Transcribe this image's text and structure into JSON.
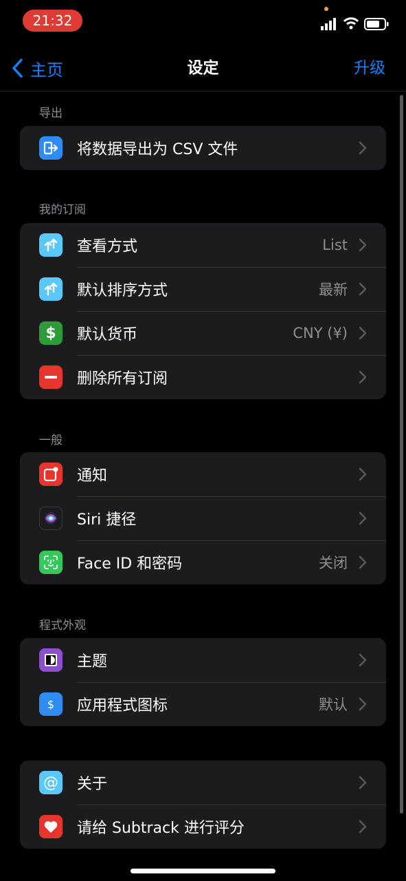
{
  "status_bar": {
    "time": "21:32"
  },
  "nav": {
    "back_label": "主页",
    "title": "设定",
    "action_label": "升级"
  },
  "sections": {
    "export": {
      "header": "导出",
      "rows": [
        {
          "label": "将数据导出为 CSV 文件",
          "icon": "export-icon",
          "color": "#2f8cf0"
        }
      ]
    },
    "subscriptions": {
      "header": "我的订阅",
      "rows": [
        {
          "label": "查看方式",
          "value": "List",
          "icon": "sort-arrows-icon",
          "color": "#5ac8fa"
        },
        {
          "label": "默认排序方式",
          "value": "最新",
          "icon": "sort-arrows-icon",
          "color": "#5ac8fa"
        },
        {
          "label": "默认货币",
          "value": "CNY (¥)",
          "icon": "dollar-icon",
          "color": "#2e9a3a"
        },
        {
          "label": "删除所有订阅",
          "icon": "minus-icon",
          "color": "#e5352c"
        }
      ]
    },
    "general": {
      "header": "一般",
      "rows": [
        {
          "label": "通知",
          "icon": "notification-icon",
          "color": "#e5352c"
        },
        {
          "label": "Siri 捷径",
          "icon": "siri-icon",
          "color": "#1c1c1e"
        },
        {
          "label": "Face ID 和密码",
          "value": "关闭",
          "icon": "face-id-icon",
          "color": "#34c759"
        }
      ]
    },
    "appearance": {
      "header": "程式外观",
      "rows": [
        {
          "label": "主题",
          "icon": "theme-icon",
          "color": "#8e4fcf"
        },
        {
          "label": "应用程式图标",
          "value": "默认",
          "icon": "app-icon",
          "color": "#2f8cf0"
        }
      ]
    },
    "about": {
      "rows": [
        {
          "label": "关于",
          "icon": "at-icon",
          "color": "#5ac8fa"
        },
        {
          "label": "请给 Subtrack 进行评分",
          "icon": "heart-icon",
          "color": "#e5352c"
        }
      ]
    }
  }
}
